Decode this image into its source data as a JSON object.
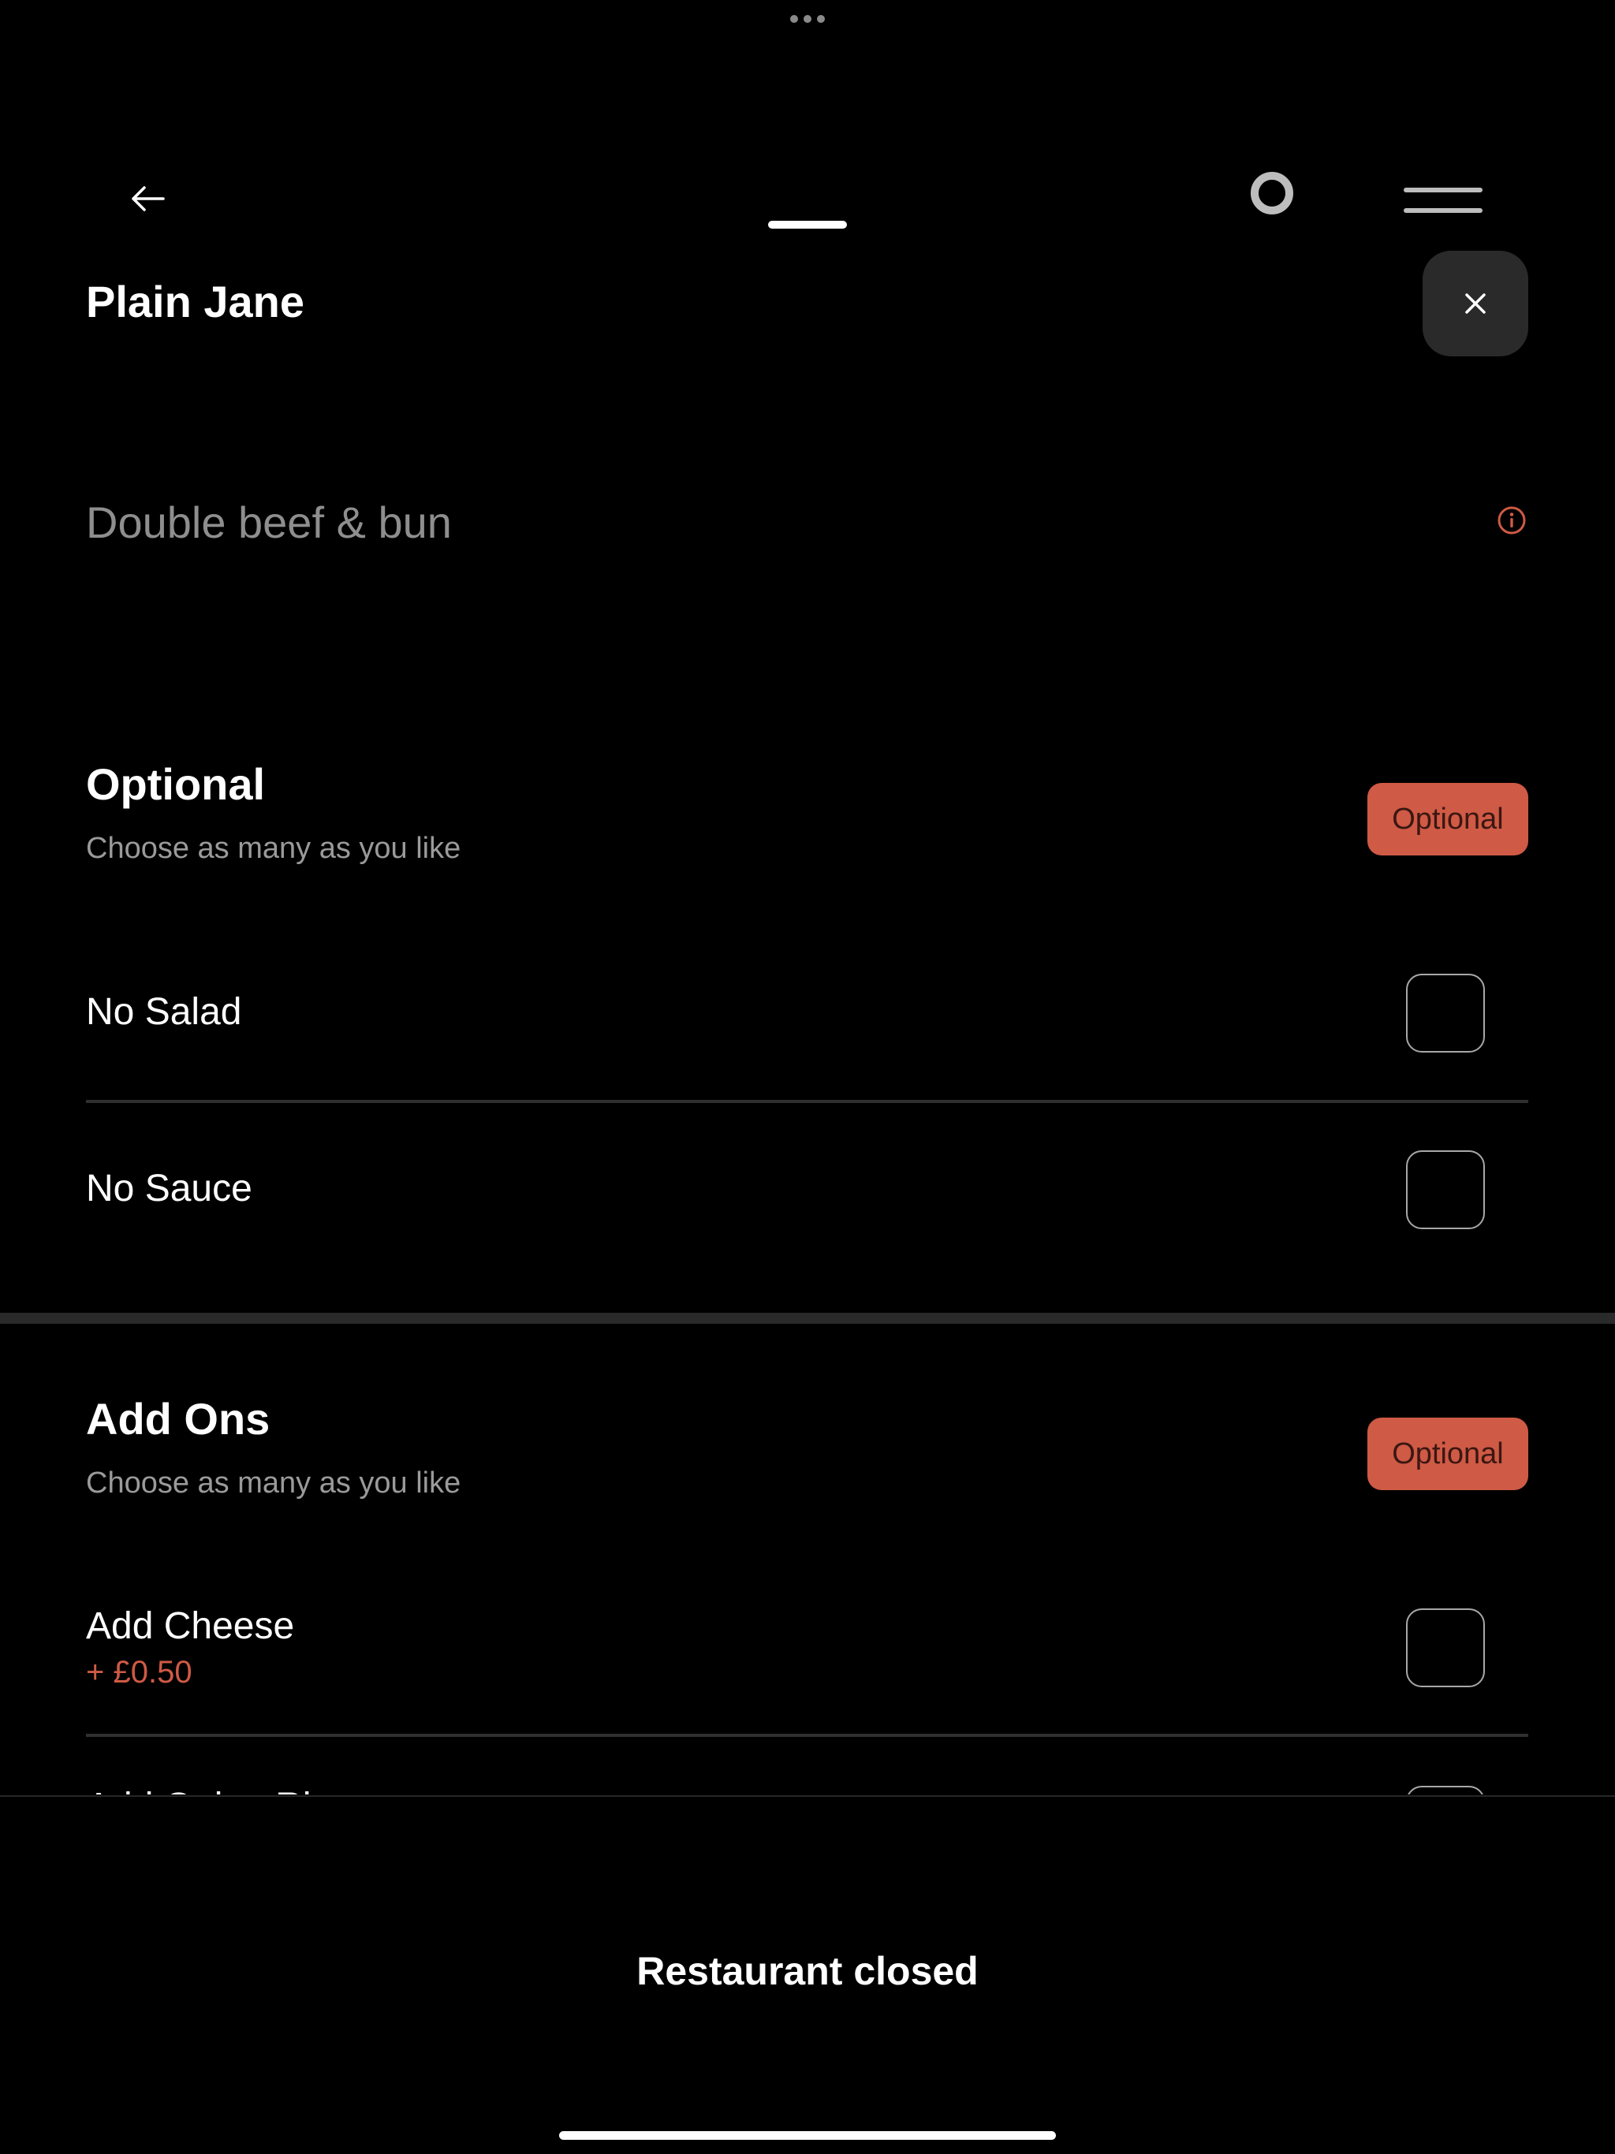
{
  "item": {
    "title": "Plain Jane",
    "description": "Double beef & bun"
  },
  "sections": [
    {
      "title": "Optional",
      "subtitle": "Choose as many as you like",
      "badge": "Optional",
      "options": [
        {
          "label": "No Salad",
          "price": ""
        },
        {
          "label": "No Sauce",
          "price": ""
        }
      ]
    },
    {
      "title": "Add Ons",
      "subtitle": "Choose as many as you like",
      "badge": "Optional",
      "options": [
        {
          "label": "Add Cheese",
          "price": "+ £0.50"
        },
        {
          "label": "Add Onion Ri",
          "price": ""
        }
      ]
    }
  ],
  "footer": {
    "status_label": "Restaurant closed"
  },
  "icons": {
    "back": "arrow-left-icon",
    "close": "close-icon",
    "info": "info-icon",
    "menu": "menu-icon",
    "record": "record-icon",
    "more": "more-dots-icon"
  },
  "colors": {
    "background": "#000000",
    "accent": "#cf5a45",
    "badge_text": "#3a1712",
    "muted_text": "#8e8e8e",
    "close_button_bg": "#2a2a2a",
    "divider": "#2f2f2f"
  }
}
